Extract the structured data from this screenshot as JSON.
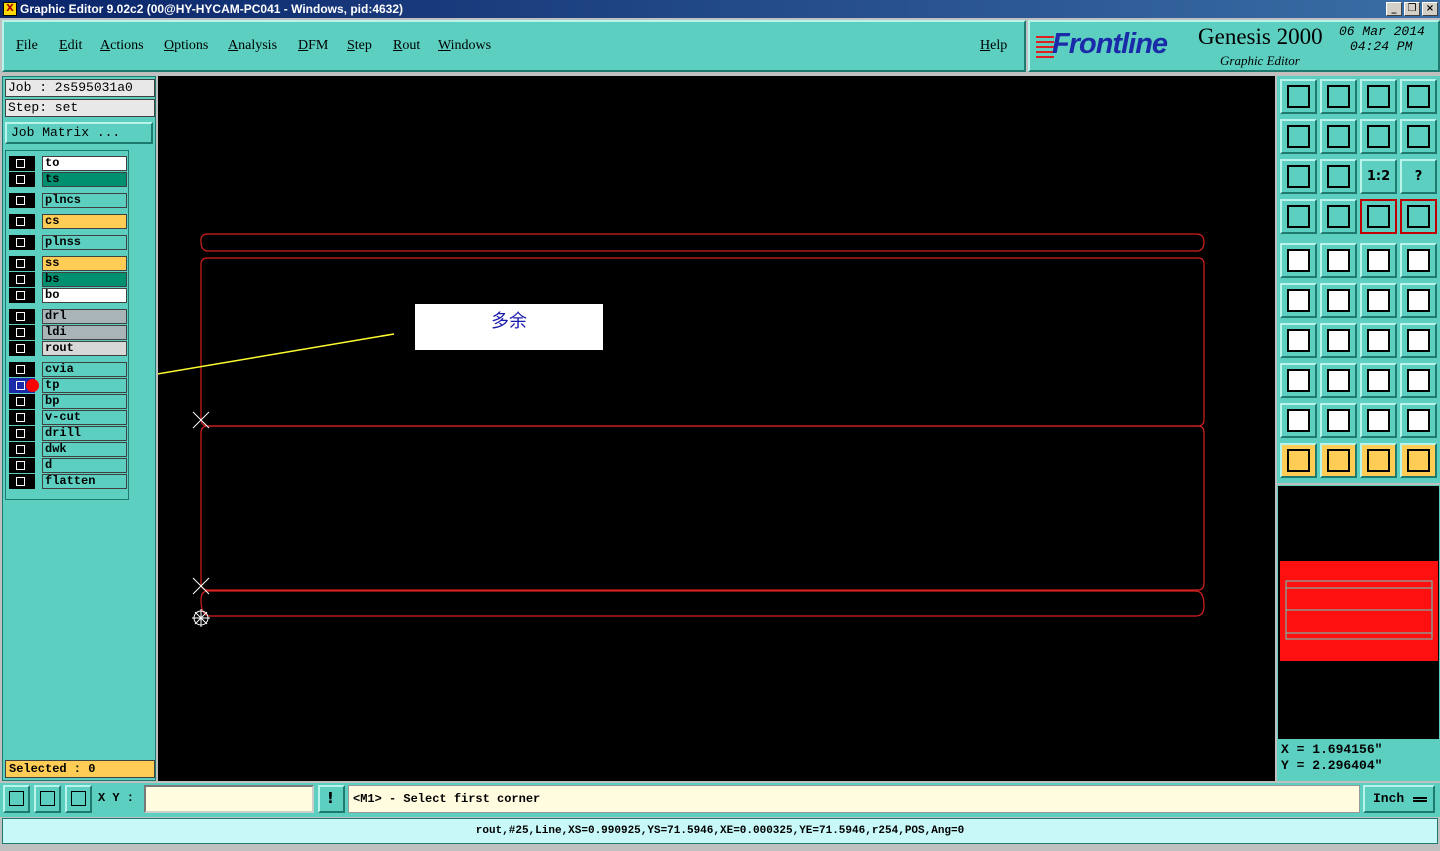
{
  "window": {
    "title": "Graphic Editor 9.02c2 (00@HY-HYCAM-PC041 - Windows, pid:4632)"
  },
  "menu": [
    "File",
    "Edit",
    "Actions",
    "Options",
    "Analysis",
    "DFM",
    "Step",
    "Rout",
    "Windows"
  ],
  "help": "Help",
  "brand": {
    "logo": "Frontline",
    "product": "Genesis 2000",
    "subtitle": "Graphic Editor",
    "date": "06 Mar 2014",
    "time": "04:24 PM"
  },
  "job": {
    "job_label": "Job : 2s595031a0",
    "step_label": "Step: set",
    "matrix_button": "Job Matrix ..."
  },
  "layers": [
    {
      "name": "to",
      "color": "#ffffff",
      "active": false
    },
    {
      "name": "ts",
      "color": "#009070",
      "active": false
    },
    {
      "name": "plncs",
      "color": "#5ccfc0",
      "active": false
    },
    {
      "name": "cs",
      "color": "#ffcc55",
      "active": false
    },
    {
      "name": "plnss",
      "color": "#5ccfc0",
      "active": false
    },
    {
      "name": "ss",
      "color": "#ffcc55",
      "active": false
    },
    {
      "name": "bs",
      "color": "#009070",
      "active": false
    },
    {
      "name": "bo",
      "color": "#ffffff",
      "active": false
    },
    {
      "name": "drl",
      "color": "#a8b4b8",
      "active": false
    },
    {
      "name": "ldi",
      "color": "#a8b4b8",
      "active": false
    },
    {
      "name": "rout",
      "color": "#d8d8d8",
      "active": false
    },
    {
      "name": "cvia",
      "color": "#5ccfc0",
      "active": false
    },
    {
      "name": "tp",
      "color": "#5ccfc0",
      "active": true
    },
    {
      "name": "bp",
      "color": "#5ccfc0",
      "active": false
    },
    {
      "name": "v-cut",
      "color": "#5ccfc0",
      "active": false
    },
    {
      "name": "drill",
      "color": "#5ccfc0",
      "active": false
    },
    {
      "name": "dwk",
      "color": "#5ccfc0",
      "active": false
    },
    {
      "name": "d",
      "color": "#5ccfc0",
      "active": false
    },
    {
      "name": "flatten",
      "color": "#5ccfc0",
      "active": false
    }
  ],
  "selected": "Selected : 0",
  "annotation": {
    "text": "多余"
  },
  "coords": {
    "x": "X = 1.694156\"",
    "y": "Y = 2.296404\""
  },
  "bottom": {
    "xy_label": "X Y :",
    "xy_value": "",
    "message": "<M1> - Select first corner",
    "unit": "Inch",
    "status": "rout,#25,Line,XS=0.990925,YS=71.5946,XE=0.000325,YE=71.5946,r254,POS,Ang=0"
  },
  "tools": [
    "zoom-home-icon",
    "zoom-down-icon",
    "home-icon",
    "window-icon",
    "pan-left-icon",
    "pan-right-icon",
    "swap-icon",
    "snake-icon",
    "fit-icon",
    "center-icon",
    "scale-1-2-icon",
    "help-icon",
    "tools-icon",
    "grid-icon",
    "net-red-icon",
    "net-red2-icon",
    "snapshot-icon",
    "edit-shape-icon",
    "ruler-icon",
    "pad-icon",
    "connect-icon",
    "cross-icon",
    "point-red-icon",
    "point-red2-icon",
    "angle-icon",
    "line-icon",
    "rotate-icon",
    "mirror-icon",
    "pad-move-icon",
    "line-red-icon",
    "dimension-icon",
    "group-icon",
    "measure-tri-icon",
    "measure-a-icon",
    "measure-ab-icon",
    "measure-c-icon",
    "pointer-icon",
    "pointer-box-icon",
    "pointer-circle-icon",
    "route-icon"
  ],
  "tool_labels": {
    "scale": "1:2",
    "help": "?"
  }
}
